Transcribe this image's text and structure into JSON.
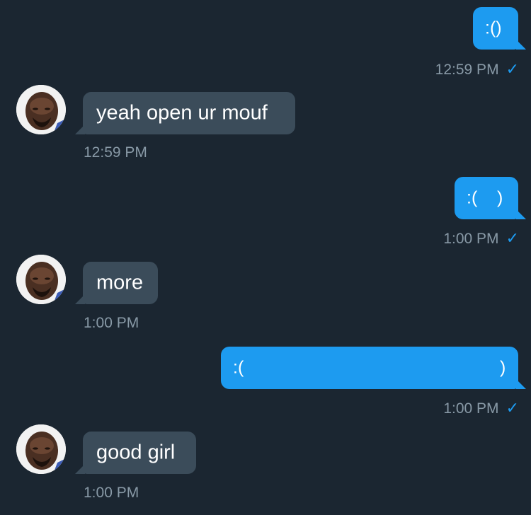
{
  "messages": [
    {
      "direction": "outgoing",
      "text": ":()",
      "time": "12:59 PM",
      "status_icon": "checkmark-icon"
    },
    {
      "direction": "incoming",
      "text": "yeah open ur mouf",
      "time": "12:59 PM"
    },
    {
      "direction": "outgoing",
      "text": ":(    )",
      "time": "1:00 PM",
      "status_icon": "checkmark-icon"
    },
    {
      "direction": "incoming",
      "text": "more",
      "time": "1:00 PM"
    },
    {
      "direction": "outgoing",
      "text_left": ":(",
      "text_right": ")",
      "time": "1:00 PM",
      "status_icon": "checkmark-icon"
    },
    {
      "direction": "incoming",
      "text": "good girl",
      "time": "1:00 PM"
    }
  ],
  "status": {
    "checkmark": "✓"
  },
  "colors": {
    "background": "#1b2631",
    "outgoing_bubble": "#1d9bf0",
    "incoming_bubble": "#3b4c5a",
    "timestamp": "#8899a6",
    "read_check": "#1d9bf0"
  }
}
